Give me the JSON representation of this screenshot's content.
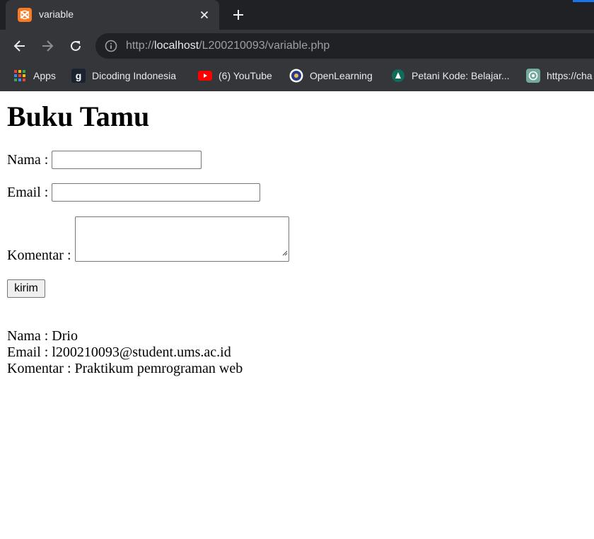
{
  "browser": {
    "tab_title": "variable",
    "url_scheme": "http://",
    "url_host": "localhost",
    "url_path": "/L200210093/variable.php",
    "bookmarks": [
      {
        "label": "Apps",
        "icon": "apps-grid-icon"
      },
      {
        "label": "Dicoding Indonesia",
        "icon": "dicoding-icon"
      },
      {
        "label": "(6) YouTube",
        "icon": "youtube-icon"
      },
      {
        "label": "OpenLearning",
        "icon": "openlearning-icon"
      },
      {
        "label": "Petani Kode: Belajar...",
        "icon": "petanikode-icon"
      },
      {
        "label": "https://cha",
        "icon": "chatgpt-icon"
      }
    ]
  },
  "page": {
    "heading": "Buku Tamu",
    "form": {
      "nama_label": "Nama :",
      "nama_value": "",
      "email_label": "Email :",
      "email_value": "",
      "komentar_label": "Komentar :",
      "komentar_value": "",
      "submit_label": "kirim"
    },
    "output": {
      "nama": "Nama : Drio",
      "email": "Email : l200210093@student.ums.ac.id",
      "komentar": "Komentar : Praktikum pemrograman web"
    }
  },
  "colors": {
    "tabstrip": "#202124",
    "toolbar": "#35363a",
    "omnibox": "#202124",
    "xampp_orange": "#fb7a24"
  }
}
